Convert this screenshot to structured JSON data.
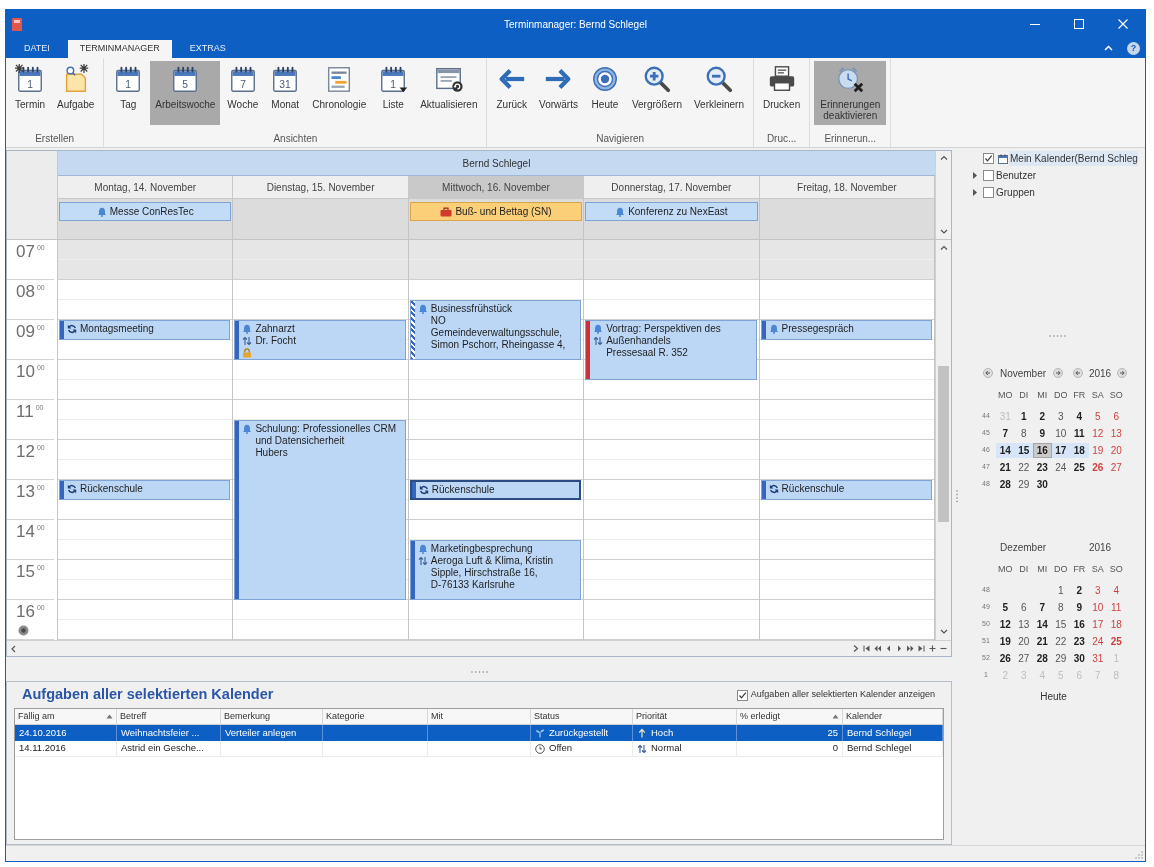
{
  "window": {
    "title": "Terminmanager: Bernd Schlegel",
    "help": "?"
  },
  "ribbon_tabs": [
    {
      "label": "DATEI",
      "selected": false
    },
    {
      "label": "TERMINMANAGER",
      "selected": true
    },
    {
      "label": "EXTRAS",
      "selected": false
    }
  ],
  "ribbon_groups": [
    {
      "label": "Erstellen",
      "buttons": [
        {
          "label": "Termin",
          "kind": "new_appointment",
          "icon_text": "1",
          "selected": false
        },
        {
          "label": "Aufgabe",
          "kind": "new_task",
          "selected": false
        }
      ]
    },
    {
      "label": "Ansichten",
      "buttons": [
        {
          "label": "Tag",
          "kind": "calendar",
          "icon_text": "1",
          "selected": false
        },
        {
          "label": "Arbeitswoche",
          "kind": "calendar",
          "icon_text": "5",
          "selected": true
        },
        {
          "label": "Woche",
          "kind": "calendar",
          "icon_text": "7",
          "selected": false
        },
        {
          "label": "Monat",
          "kind": "calendar",
          "icon_text": "31",
          "selected": false
        },
        {
          "label": "Chronologie",
          "kind": "timeline",
          "selected": false
        },
        {
          "label": "Liste",
          "kind": "list",
          "icon_text": "1",
          "selected": false
        },
        {
          "label": "Aktualisieren",
          "kind": "refresh",
          "selected": false
        }
      ]
    },
    {
      "label": "Navigieren",
      "buttons": [
        {
          "label": "Zurück",
          "kind": "back",
          "selected": false
        },
        {
          "label": "Vorwärts",
          "kind": "forward",
          "selected": false
        },
        {
          "label": "Heute",
          "kind": "today",
          "selected": false
        },
        {
          "label": "Vergrößern",
          "kind": "zoom_in",
          "selected": false
        },
        {
          "label": "Verkleinern",
          "kind": "zoom_out",
          "selected": false
        }
      ]
    },
    {
      "label": "Druc...",
      "buttons": [
        {
          "label": "Drucken",
          "kind": "print",
          "selected": false
        }
      ]
    },
    {
      "label": "Erinnerun...",
      "buttons": [
        {
          "label": "Erinnerungen deaktivieren",
          "kind": "reminder_off",
          "selected": true
        }
      ]
    }
  ],
  "scheduler": {
    "resource": "Bernd Schlegel",
    "time_axis": [
      {
        "hour": "07",
        "minutes": "00",
        "working": false
      },
      {
        "hour": "08",
        "minutes": "00",
        "working": true
      },
      {
        "hour": "09",
        "minutes": "00",
        "working": true
      },
      {
        "hour": "10",
        "minutes": "00",
        "working": true
      },
      {
        "hour": "11",
        "minutes": "00",
        "working": true
      },
      {
        "hour": "12",
        "minutes": "00",
        "working": true
      },
      {
        "hour": "13",
        "minutes": "00",
        "working": true
      },
      {
        "hour": "14",
        "minutes": "00",
        "working": true
      },
      {
        "hour": "15",
        "minutes": "00",
        "working": true
      },
      {
        "hour": "16",
        "minutes": "00",
        "working": true
      }
    ],
    "days": [
      {
        "label": "Montag, 14. November",
        "today": false,
        "all_day": [
          {
            "title": "Messe ConResTec",
            "kind": "single"
          }
        ],
        "appointments": [
          {
            "title": "Montagsmeeting",
            "kind": "busy",
            "recurring": true,
            "priority_flag": false,
            "private": false,
            "selected": false
          },
          {
            "title": "Rückenschule",
            "kind": "busy",
            "recurring": true,
            "priority_flag": false,
            "private": false,
            "selected": false
          }
        ]
      },
      {
        "label": "Dienstag, 15. November",
        "today": false,
        "appointments": [
          {
            "title": "Zahnarzt",
            "details": [
              "Dr. Focht"
            ],
            "kind": "busy",
            "recurring": false,
            "priority_flag": true,
            "private": true,
            "selected": false
          },
          {
            "title": "Schulung: Professionelles CRM und Datensicherheit",
            "details": [
              "Hubers"
            ],
            "kind": "busy",
            "recurring": false,
            "priority_flag": false,
            "private": false,
            "selected": false
          }
        ]
      },
      {
        "label": "Mittwoch, 16. November",
        "today": true,
        "all_day": [
          {
            "title": "Buß- und Bettag (SN)",
            "kind": "holiday"
          }
        ],
        "appointments": [
          {
            "title": "Businessfrühstück",
            "details": [
              "NO",
              "Gemeindeverwaltungsschule,",
              "Simon Pschorr, Rheingasse 4,"
            ],
            "kind": "tentative",
            "recurring": false,
            "priority_flag": false,
            "private": false,
            "selected": false
          },
          {
            "title": "Rückenschule",
            "kind": "busy",
            "recurring": true,
            "priority_flag": false,
            "private": false,
            "selected": true
          },
          {
            "title": "Marketingbesprechung",
            "details": [
              "Aeroga Luft & Klima, Kristin Sipple, Hirschstraße 16, D-76133 Karlsruhe"
            ],
            "kind": "busy",
            "recurring": false,
            "priority_flag": true,
            "private": false,
            "selected": false
          }
        ]
      },
      {
        "label": "Donnerstag, 17. November",
        "today": false,
        "all_day": [
          {
            "title": "Konferenz zu NexEast",
            "kind": "single"
          }
        ],
        "appointments": [
          {
            "title": "Vortrag: Perspektiven des Außenhandels",
            "details": [
              "Pressesaal R. 352"
            ],
            "kind": "out_of_office",
            "recurring": false,
            "priority_flag": true,
            "private": false,
            "selected": false
          }
        ]
      },
      {
        "label": "Freitag, 18. November",
        "today": false,
        "appointments": [
          {
            "title": "Pressegespräch",
            "kind": "busy",
            "recurring": false,
            "priority_flag": false,
            "private": false,
            "selected": false
          },
          {
            "title": "Rückenschule",
            "kind": "busy",
            "recurring": true,
            "priority_flag": false,
            "private": false,
            "selected": false
          }
        ]
      }
    ]
  },
  "calendar_tree": [
    {
      "label": "Mein Kalender(Bernd Schleg",
      "kind": "calendar",
      "checked": true,
      "selected": true
    },
    {
      "label": "Benutzer",
      "kind": "group",
      "checked": false,
      "selected": false,
      "expanded": false
    },
    {
      "label": "Gruppen",
      "kind": "group",
      "checked": false,
      "selected": false,
      "expanded": false
    }
  ],
  "mini_calendars": [
    {
      "month": "November",
      "year": "2016",
      "navigation": true,
      "weekdays": [
        "MO",
        "DI",
        "MI",
        "DO",
        "FR",
        "SA",
        "SO"
      ],
      "weeks": [
        {
          "number": "44",
          "days": [
            {
              "day": "31",
              "kind": "other_month",
              "selected": false
            },
            {
              "day": "1",
              "kind": "busy",
              "selected": false
            },
            {
              "day": "2",
              "kind": "busy",
              "selected": false
            },
            {
              "day": "3",
              "kind": "plain",
              "selected": false
            },
            {
              "day": "4",
              "kind": "busy",
              "selected": false
            },
            {
              "day": "5",
              "kind": "weekend",
              "selected": false
            },
            {
              "day": "6",
              "kind": "weekend",
              "selected": false
            }
          ]
        },
        {
          "number": "45",
          "days": [
            {
              "day": "7",
              "kind": "busy",
              "selected": false
            },
            {
              "day": "8",
              "kind": "plain",
              "selected": false
            },
            {
              "day": "9",
              "kind": "busy",
              "selected": false
            },
            {
              "day": "10",
              "kind": "plain",
              "selected": false
            },
            {
              "day": "11",
              "kind": "busy",
              "selected": false
            },
            {
              "day": "12",
              "kind": "weekend",
              "selected": false
            },
            {
              "day": "13",
              "kind": "weekend",
              "selected": false
            }
          ]
        },
        {
          "number": "46",
          "days": [
            {
              "day": "14",
              "kind": "busy",
              "selected": true
            },
            {
              "day": "15",
              "kind": "busy",
              "selected": true
            },
            {
              "day": "16",
              "kind": "today",
              "selected": true
            },
            {
              "day": "17",
              "kind": "busy",
              "selected": true
            },
            {
              "day": "18",
              "kind": "busy",
              "selected": true
            },
            {
              "day": "19",
              "kind": "weekend",
              "selected": false
            },
            {
              "day": "20",
              "kind": "weekend",
              "selected": false
            }
          ]
        },
        {
          "number": "47",
          "days": [
            {
              "day": "21",
              "kind": "busy",
              "selected": false
            },
            {
              "day": "22",
              "kind": "plain",
              "selected": false
            },
            {
              "day": "23",
              "kind": "busy",
              "selected": false
            },
            {
              "day": "24",
              "kind": "plain",
              "selected": false
            },
            {
              "day": "25",
              "kind": "busy",
              "selected": false
            },
            {
              "day": "26",
              "kind": "weekend_busy",
              "selected": false
            },
            {
              "day": "27",
              "kind": "weekend",
              "selected": false
            }
          ]
        },
        {
          "number": "48",
          "days": [
            {
              "day": "28",
              "kind": "busy",
              "selected": false
            },
            {
              "day": "29",
              "kind": "plain",
              "selected": false
            },
            {
              "day": "30",
              "kind": "busy",
              "selected": false
            }
          ]
        }
      ]
    },
    {
      "month": "Dezember",
      "year": "2016",
      "navigation": false,
      "weekdays": [
        "MO",
        "DI",
        "MI",
        "DO",
        "FR",
        "SA",
        "SO"
      ],
      "weeks": [
        {
          "number": "48",
          "days": [
            {
              "day": "1",
              "kind": "plain",
              "selected": false
            },
            {
              "day": "2",
              "kind": "busy",
              "selected": false
            },
            {
              "day": "3",
              "kind": "weekend",
              "selected": false
            },
            {
              "day": "4",
              "kind": "weekend",
              "selected": false
            }
          ]
        },
        {
          "number": "49",
          "days": [
            {
              "day": "5",
              "kind": "busy",
              "selected": false
            },
            {
              "day": "6",
              "kind": "plain",
              "selected": false
            },
            {
              "day": "7",
              "kind": "busy",
              "selected": false
            },
            {
              "day": "8",
              "kind": "plain",
              "selected": false
            },
            {
              "day": "9",
              "kind": "busy",
              "selected": false
            },
            {
              "day": "10",
              "kind": "weekend",
              "selected": false
            },
            {
              "day": "11",
              "kind": "weekend",
              "selected": false
            }
          ]
        },
        {
          "number": "50",
          "days": [
            {
              "day": "12",
              "kind": "busy",
              "selected": false
            },
            {
              "day": "13",
              "kind": "plain",
              "selected": false
            },
            {
              "day": "14",
              "kind": "busy",
              "selected": false
            },
            {
              "day": "15",
              "kind": "plain",
              "selected": false
            },
            {
              "day": "16",
              "kind": "busy",
              "selected": false
            },
            {
              "day": "17",
              "kind": "weekend",
              "selected": false
            },
            {
              "day": "18",
              "kind": "weekend",
              "selected": false
            }
          ]
        },
        {
          "number": "51",
          "days": [
            {
              "day": "19",
              "kind": "busy",
              "selected": false
            },
            {
              "day": "20",
              "kind": "plain",
              "selected": false
            },
            {
              "day": "21",
              "kind": "busy",
              "selected": false
            },
            {
              "day": "22",
              "kind": "plain",
              "selected": false
            },
            {
              "day": "23",
              "kind": "busy",
              "selected": false
            },
            {
              "day": "24",
              "kind": "weekend",
              "selected": false
            },
            {
              "day": "25",
              "kind": "weekend_busy",
              "selected": false
            }
          ]
        },
        {
          "number": "52",
          "days": [
            {
              "day": "26",
              "kind": "busy",
              "selected": false
            },
            {
              "day": "27",
              "kind": "plain",
              "selected": false
            },
            {
              "day": "28",
              "kind": "busy",
              "selected": false
            },
            {
              "day": "29",
              "kind": "plain",
              "selected": false
            },
            {
              "day": "30",
              "kind": "busy",
              "selected": false
            },
            {
              "day": "31",
              "kind": "weekend",
              "selected": false
            },
            {
              "day": "1",
              "kind": "other_month",
              "selected": false
            }
          ]
        },
        {
          "number": "1",
          "days": [
            {
              "day": "2",
              "kind": "other_month",
              "selected": false
            },
            {
              "day": "3",
              "kind": "other_month",
              "selected": false
            },
            {
              "day": "4",
              "kind": "other_month",
              "selected": false
            },
            {
              "day": "5",
              "kind": "other_month",
              "selected": false
            },
            {
              "day": "6",
              "kind": "other_month",
              "selected": false
            },
            {
              "day": "7",
              "kind": "other_month",
              "selected": false
            },
            {
              "day": "8",
              "kind": "other_month",
              "selected": false
            }
          ]
        }
      ]
    }
  ],
  "today_button": "Heute",
  "tasks": {
    "title": "Aufgaben aller selektierten Kalender",
    "show_all": {
      "label": "Aufgaben aller selektierten Kalender anzeigen",
      "checked": true
    },
    "columns": [
      {
        "label": "Fällig am",
        "sorted": true
      },
      {
        "label": "Betreff",
        "sorted": false
      },
      {
        "label": "Bemerkung",
        "sorted": false
      },
      {
        "label": "Kategorie",
        "sorted": false
      },
      {
        "label": "Mit",
        "sorted": false
      },
      {
        "label": "Status",
        "sorted": false
      },
      {
        "label": "Priorität",
        "sorted": false
      },
      {
        "label": "% erledigt",
        "sorted": true
      },
      {
        "label": "Kalender",
        "sorted": false
      }
    ],
    "rows": [
      {
        "selected": true,
        "due": "24.10.2016",
        "subject": "Weihnachtsfeier ...",
        "remark": "Verteiler anlegen",
        "status": {
          "label": "Zurückgestellt",
          "kind": "deferred"
        },
        "priority": {
          "label": "Hoch",
          "kind": "high"
        },
        "done": "25",
        "calendar": "Bernd Schlegel"
      },
      {
        "selected": false,
        "due": "14.11.2016",
        "subject": "Astrid ein Gesche...",
        "status": {
          "label": "Offen",
          "kind": "open"
        },
        "priority": {
          "label": "Normal",
          "kind": "normal"
        },
        "done": "0",
        "calendar": "Bernd Schlegel"
      }
    ]
  }
}
